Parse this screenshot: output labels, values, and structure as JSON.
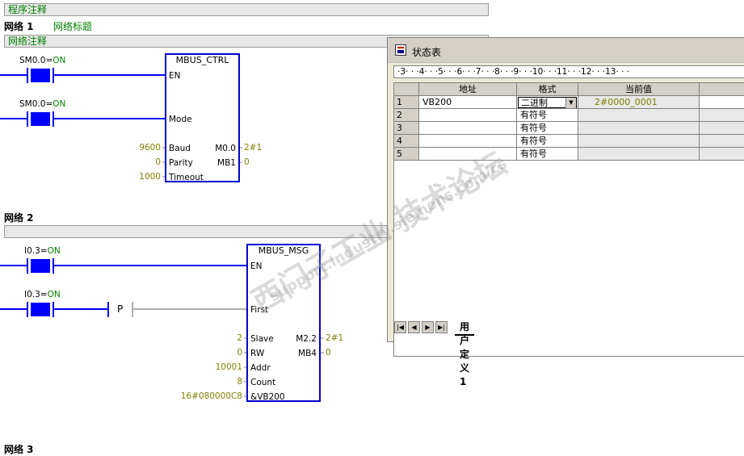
{
  "program_comment": "程序注释",
  "network1": {
    "title": "网络 1",
    "subtitle": "网络标题",
    "comment": "网络注释",
    "contact1": {
      "label": "SM0.0",
      "state": "ON"
    },
    "contact2": {
      "label": "SM0.0",
      "state": "ON"
    },
    "block": {
      "name": "MBUS_CTRL",
      "inputs": [
        "EN",
        "Mode",
        "Baud",
        "Parity",
        "Timeout"
      ],
      "outputs": [
        "M0.0",
        "MB1"
      ],
      "input_values": {
        "baud": "9600",
        "parity": "0",
        "timeout": "1000"
      },
      "output_values": {
        "m0": "2#1",
        "mb1": "0"
      }
    }
  },
  "network2": {
    "title": "网络 2",
    "contact1": {
      "label": "I0.3",
      "state": "ON"
    },
    "contact2": {
      "label": "I0.3",
      "state": "ON"
    },
    "pcoil": "P",
    "block": {
      "name": "MBUS_MSG",
      "inputs": [
        "EN",
        "First",
        "Slave",
        "RW",
        "Addr",
        "Count",
        "&VB200"
      ],
      "outputs": [
        "M2.2",
        "MB4"
      ],
      "input_values": {
        "slave": "2",
        "rw": "0",
        "addr": "10001",
        "count": "8",
        "ptr": "16#080000C8"
      },
      "output_values": {
        "m22": "2#1",
        "mb4": "0"
      }
    }
  },
  "network3": {
    "title": "网络 3"
  },
  "status_window": {
    "title": "状态表",
    "ruler": "·3· · ·4· · ·5· · ·6· · ·7· · ·8· · ·9· · ·10· · ·11· · ·12· · ·13· · ·",
    "columns": [
      "地址",
      "格式",
      "当前值"
    ],
    "rows": [
      {
        "num": "1",
        "address": "VB200",
        "format": "二进制",
        "value": "2#0000_0001"
      },
      {
        "num": "2",
        "address": "",
        "format": "有符号",
        "value": ""
      },
      {
        "num": "3",
        "address": "",
        "format": "有符号",
        "value": ""
      },
      {
        "num": "4",
        "address": "",
        "format": "有符号",
        "value": ""
      },
      {
        "num": "5",
        "address": "",
        "format": "有符号",
        "value": ""
      }
    ],
    "tab": "用户定义1"
  },
  "watermark": {
    "line1": "西门子工业 技术论坛",
    "line2": "support.industry.siemens.com/cs"
  },
  "colors": {
    "block_border": "#0000d0",
    "contact_fill": "#0000ff",
    "value_olive": "#808000",
    "comment_green": "#008000"
  }
}
